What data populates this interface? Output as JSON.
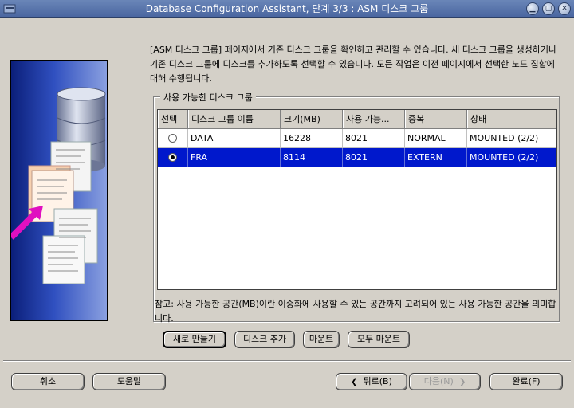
{
  "window": {
    "title": "Database Configuration Assistant, 단계 3/3 : ASM 디스크 그룹"
  },
  "intro_text": "[ASM 디스크 그룹] 페이지에서 기존 디스크 그룹을 확인하고 관리할 수 있습니다. 새 디스크 그룹을 생성하거나 기존 디스크 그룹에 디스크를 추가하도록 선택할 수 있습니다. 모든 작업은 이전 페이지에서 선택한 노드 집합에 대해 수행됩니다.",
  "group": {
    "legend": "사용 가능한 디스크 그룹",
    "columns": [
      "선택",
      "디스크 그룹 이름",
      "크기(MB)",
      "사용 가능...",
      "중복",
      "상태"
    ],
    "rows": [
      {
        "selected": false,
        "name": "DATA",
        "size": "16228",
        "free": "8021",
        "redundancy": "NORMAL",
        "state": "MOUNTED (2/2)"
      },
      {
        "selected": true,
        "name": "FRA",
        "size": "8114",
        "free": "8021",
        "redundancy": "EXTERN",
        "state": "MOUNTED (2/2)"
      }
    ]
  },
  "note_text": "참고: 사용 가능한 공간(MB)이란 이중화에 사용할 수 있는 공간까지 고려되어 있는 사용 가능한 공간을 의미합니다.",
  "actions": {
    "create": "새로 만들기",
    "add_disks": "디스크 추가",
    "mount": "마운트",
    "mount_all": "모두 마운트"
  },
  "footer": {
    "cancel": "취소",
    "help": "도움말",
    "back": "뒤로(B)",
    "next": "다음(N)",
    "finish": "완료(F)"
  }
}
